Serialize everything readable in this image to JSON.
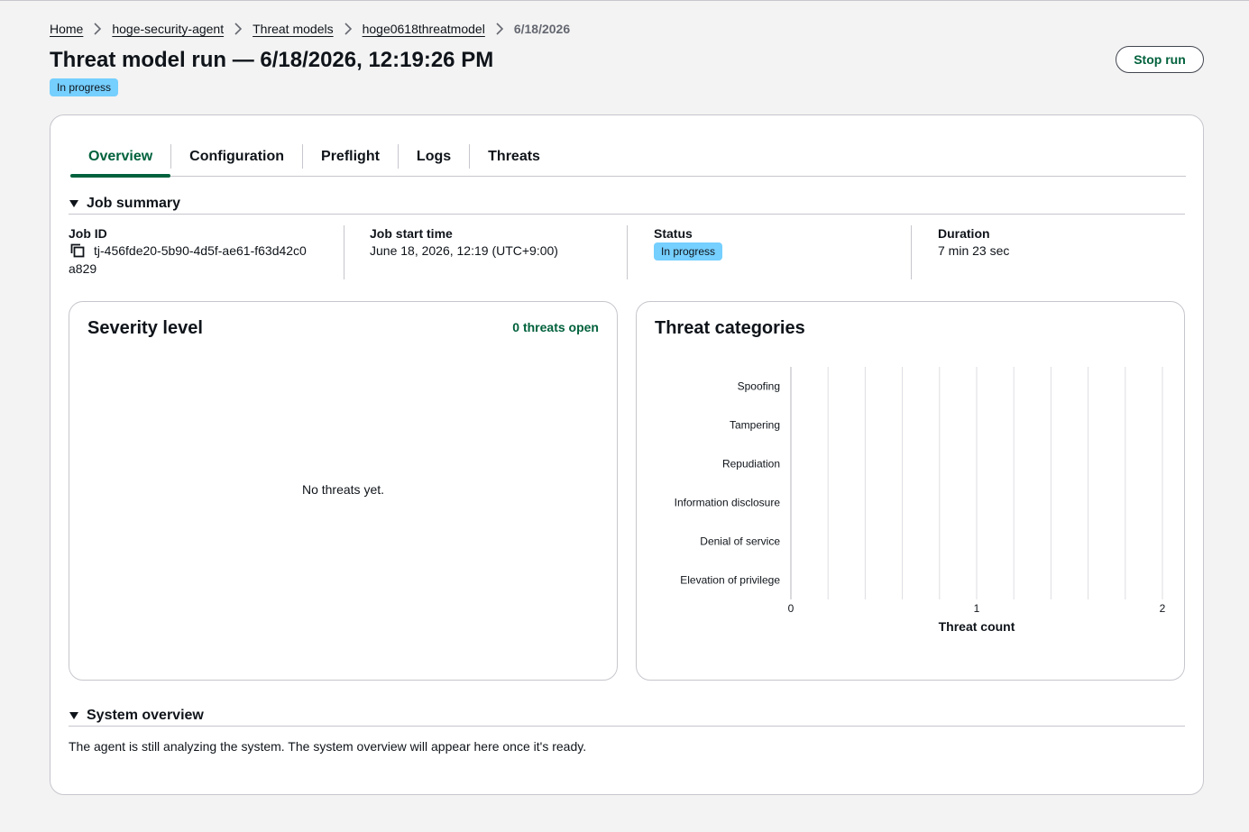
{
  "breadcrumb": {
    "items": [
      "Home",
      "hoge-security-agent",
      "Threat models",
      "hoge0618threatmodel"
    ],
    "current": "6/18/2026"
  },
  "header": {
    "title": "Threat model run — 6/18/2026, 12:19:26 PM",
    "status_badge": "In progress",
    "stop_button": "Stop run"
  },
  "tabs": [
    {
      "label": "Overview",
      "active": true
    },
    {
      "label": "Configuration",
      "active": false
    },
    {
      "label": "Preflight",
      "active": false
    },
    {
      "label": "Logs",
      "active": false
    },
    {
      "label": "Threats",
      "active": false
    }
  ],
  "job_summary": {
    "heading": "Job summary",
    "job_id_label": "Job ID",
    "job_id_line1": "tj-456fde20-5b90-4d5f-ae61-f63d42c0",
    "job_id_line2": "a829",
    "start_label": "Job start time",
    "start_value": "June 18, 2026, 12:19 (UTC+9:00)",
    "status_label": "Status",
    "status_value": "In progress",
    "duration_label": "Duration",
    "duration_value": "7 min 23 sec"
  },
  "severity": {
    "title": "Severity level",
    "threats_open": "0 threats open",
    "empty": "No threats yet."
  },
  "categories": {
    "title": "Threat categories"
  },
  "chart_data": {
    "type": "bar",
    "orientation": "horizontal",
    "categories": [
      "Spoofing",
      "Tampering",
      "Repudiation",
      "Information disclosure",
      "Denial of service",
      "Elevation of privilege"
    ],
    "values": [
      0,
      0,
      0,
      0,
      0,
      0
    ],
    "xlabel": "Threat count",
    "xlim": [
      0,
      2
    ],
    "xticks": [
      "0",
      "1",
      "2"
    ],
    "grid": true,
    "bar_color": "#00613c",
    "grid_color": "#dedee3"
  },
  "system_overview": {
    "heading": "System overview",
    "text": "The agent is still analyzing the system. The system overview will appear here once it's ready."
  },
  "colors": {
    "accent": "#00613c",
    "badge": "#75cfff",
    "border": "#c6c6cd"
  }
}
